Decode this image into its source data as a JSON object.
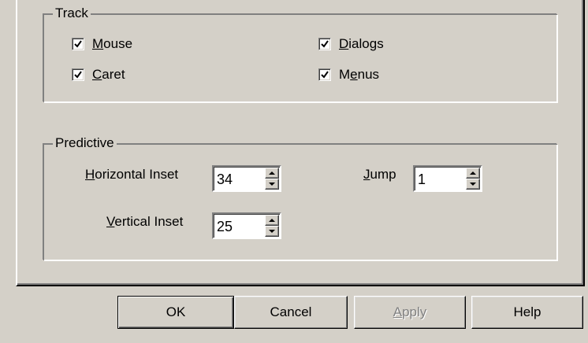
{
  "track": {
    "title": "Track",
    "checkboxes": [
      {
        "pre": "",
        "u": "M",
        "post": "ouse",
        "checked": true
      },
      {
        "pre": "",
        "u": "C",
        "post": "aret",
        "checked": true
      },
      {
        "pre": "",
        "u": "D",
        "post": "ialogs",
        "checked": true
      },
      {
        "pre": "M",
        "u": "e",
        "post": "nus",
        "checked": true
      }
    ]
  },
  "predictive": {
    "title": "Predictive",
    "horizontal": {
      "pre": "",
      "u": "H",
      "post": "orizontal Inset",
      "value": "34"
    },
    "vertical": {
      "pre": "",
      "u": "V",
      "post": "ertical Inset",
      "value": "25"
    },
    "jump": {
      "pre": "",
      "u": "J",
      "post": "ump",
      "value": "1"
    }
  },
  "buttons": {
    "ok": "OK",
    "cancel": "Cancel",
    "apply": {
      "pre": "",
      "u": "A",
      "post": "pply",
      "disabled": true
    },
    "help": "Help"
  },
  "colors": {
    "face": "#d4d0c8",
    "shadow": "#808080",
    "highlight": "#ffffff",
    "disabled_text": "#808080"
  }
}
